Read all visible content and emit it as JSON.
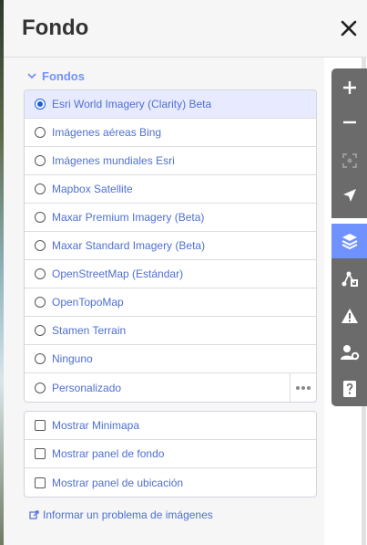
{
  "pane": {
    "title": "Fondo"
  },
  "background_section": {
    "title": "Fondos",
    "options": [
      {
        "label": "Esri World Imagery (Clarity) Beta",
        "selected": true
      },
      {
        "label": "Imágenes aéreas Bing",
        "selected": false
      },
      {
        "label": "Imágenes mundiales Esri",
        "selected": false
      },
      {
        "label": "Mapbox Satellite",
        "selected": false
      },
      {
        "label": "Maxar Premium Imagery (Beta)",
        "selected": false
      },
      {
        "label": "Maxar Standard Imagery (Beta)",
        "selected": false
      },
      {
        "label": "OpenStreetMap (Estándar)",
        "selected": false
      },
      {
        "label": "OpenTopoMap",
        "selected": false
      },
      {
        "label": "Stamen Terrain",
        "selected": false
      },
      {
        "label": "Ninguno",
        "selected": false
      },
      {
        "label": "Personalizado",
        "selected": false
      }
    ]
  },
  "display_options": [
    {
      "label": "Mostrar Minimapa",
      "checked": false
    },
    {
      "label": "Mostrar panel de fondo",
      "checked": false
    },
    {
      "label": "Mostrar panel de ubicación",
      "checked": false
    }
  ],
  "report_link": "Informar un problema de imágenes",
  "toolbar": {
    "tools": [
      {
        "icon": "zoom-in-icon"
      },
      {
        "icon": "zoom-out-icon"
      },
      {
        "icon": "zoom-to-selection-icon"
      },
      {
        "icon": "geolocate-icon"
      },
      {
        "icon": "layers-icon",
        "active": true
      },
      {
        "icon": "map-data-icon"
      },
      {
        "icon": "issues-icon"
      },
      {
        "icon": "preferences-icon"
      },
      {
        "icon": "help-icon"
      }
    ]
  },
  "colors": {
    "accent": "#7092ff",
    "selected_row": "#e8ebff",
    "toolbar": "#6b6b6b",
    "label": "#4f6fd1"
  }
}
